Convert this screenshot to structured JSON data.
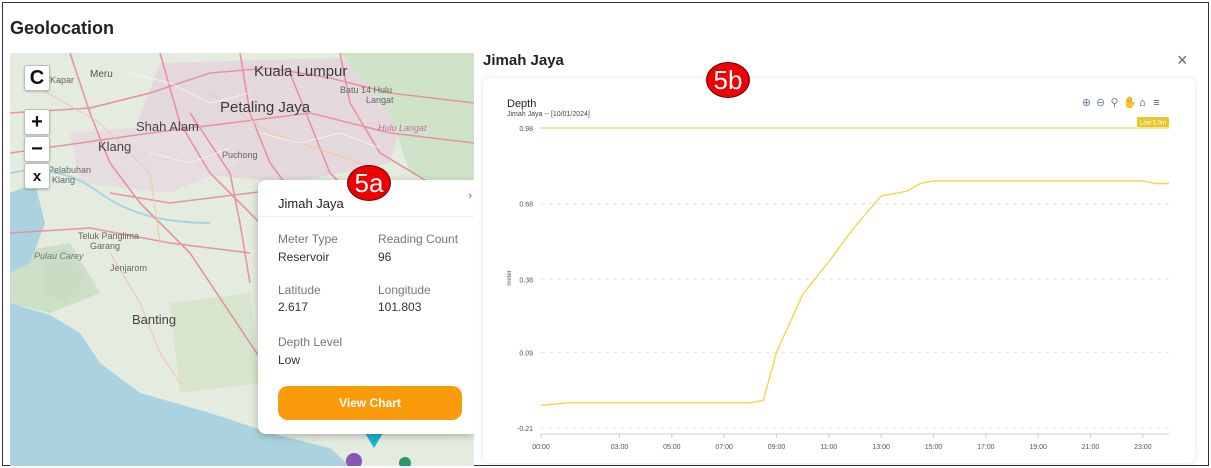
{
  "page": {
    "title": "Geolocation"
  },
  "map": {
    "controls": [
      "C",
      "+",
      "−",
      "x"
    ],
    "labels": {
      "kapar": "Kapar",
      "meru": "Meru",
      "kuala_lumpur": "Kuala Lumpur",
      "batu": "Batu 14 Hulu",
      "langat": "Langat",
      "petaling_jaya": "Petaling Jaya",
      "shah_alam": "Shah Alam",
      "hulu_langat": "Hulu Langat",
      "klang": "Klang",
      "puchong": "Puchong",
      "pelabuhan": "Pelabuhan",
      "klang2": "Klang",
      "teluk": "Teluk Panglima",
      "garang": "Garang",
      "pulau": "Pulau Carey",
      "jenjarom": "Jenjarom",
      "banting": "Banting"
    },
    "popup": {
      "title": "Jimah Jaya",
      "close": "›",
      "meter_type_label": "Meter Type",
      "meter_type_value": "Reservoir",
      "reading_count_label": "Reading Count",
      "reading_count_value": "96",
      "latitude_label": "Latitude",
      "latitude_value": "2.617",
      "longitude_label": "Longitude",
      "longitude_value": "101.803",
      "depth_level_label": "Depth Level",
      "depth_level_value": "Low",
      "view_chart": "View Chart"
    },
    "badge": "5a"
  },
  "panel": {
    "title": "Jimah Jaya",
    "close": "×",
    "badge": "5b",
    "toolbar": [
      "zoom-in-icon",
      "zoom-out-icon",
      "magnify-icon",
      "pan-hand-icon",
      "home-icon",
      "menu-icon"
    ]
  },
  "chart_data": {
    "type": "line",
    "title": "Depth",
    "subtitle": "Jimah Jaya -- [10/01/2024]",
    "ylabel": "meter",
    "xlabel": "",
    "x": [
      "00:00",
      "01:00",
      "02:00",
      "03:00",
      "04:00",
      "05:00",
      "06:00",
      "07:00",
      "08:00",
      "08:30",
      "09:00",
      "10:00",
      "11:00",
      "12:00",
      "13:00",
      "13:30",
      "14:00",
      "14:30",
      "15:00",
      "17:00",
      "19:00",
      "21:00",
      "23:00",
      "23:30",
      "24:00"
    ],
    "y": [
      -0.12,
      -0.11,
      -0.11,
      -0.11,
      -0.11,
      -0.11,
      -0.11,
      -0.11,
      -0.11,
      -0.1,
      0.09,
      0.32,
      0.45,
      0.59,
      0.71,
      0.72,
      0.73,
      0.76,
      0.77,
      0.77,
      0.77,
      0.77,
      0.77,
      0.76,
      0.76
    ],
    "x_ticks": [
      "00:00",
      "03:00",
      "05:00",
      "07:00",
      "09:00",
      "11:00",
      "13:00",
      "15:00",
      "17:00",
      "19:00",
      "21:00",
      "23:00"
    ],
    "y_ticks": [
      "0.98",
      "0.68",
      "0.38",
      "0.09",
      "-0.21"
    ],
    "ylim": [
      -0.21,
      0.98
    ],
    "annotation": {
      "label": "Low:1.0m",
      "y": 0.98
    },
    "line_color": "#f5d547",
    "grid": true
  }
}
